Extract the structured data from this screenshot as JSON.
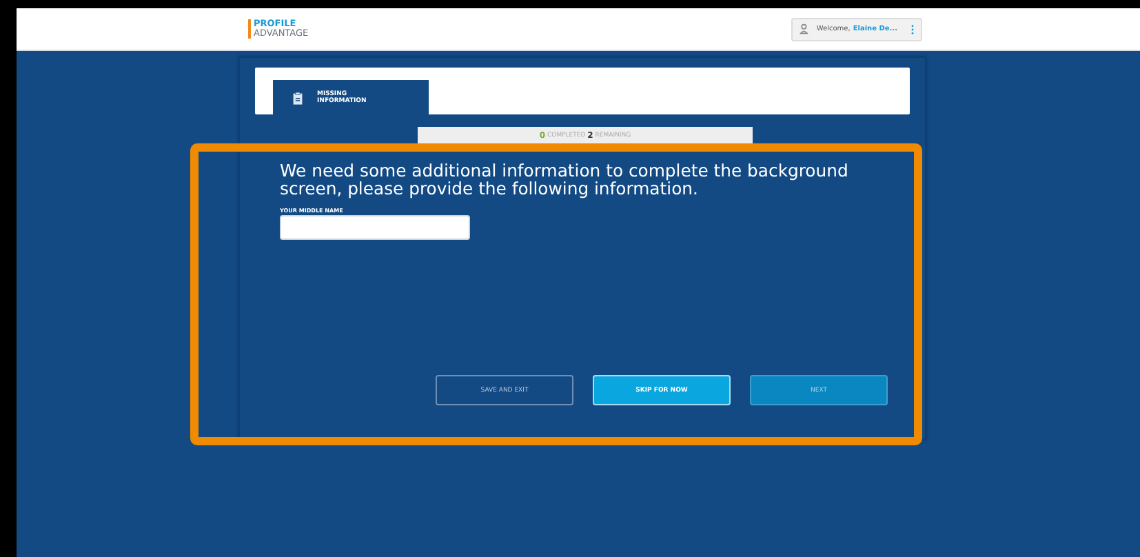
{
  "header": {
    "logo": {
      "line_1": "PROFILE",
      "line_2": "ADVANTAGE"
    },
    "user": {
      "greeting": "Welcome,",
      "name": "Elaine De..."
    }
  },
  "tabs": [
    {
      "label": "MISSING INFORMATION",
      "selected": true
    }
  ],
  "progress": {
    "completed": "0",
    "completed_label": "COMPLETED",
    "remaining": "2",
    "remaining_label": "REMAINING"
  },
  "form": {
    "heading": "We need some additional information to complete the background screen, please provide the following information.",
    "fields": [
      {
        "label": "YOUR MIDDLE NAME"
      }
    ]
  },
  "buttons": [
    {
      "label": "SAVE AND EXIT",
      "kind": "outline"
    },
    {
      "label": "SKIP FOR NOW",
      "kind": "primary"
    },
    {
      "label": "NEXT",
      "kind": "secondary"
    }
  ]
}
